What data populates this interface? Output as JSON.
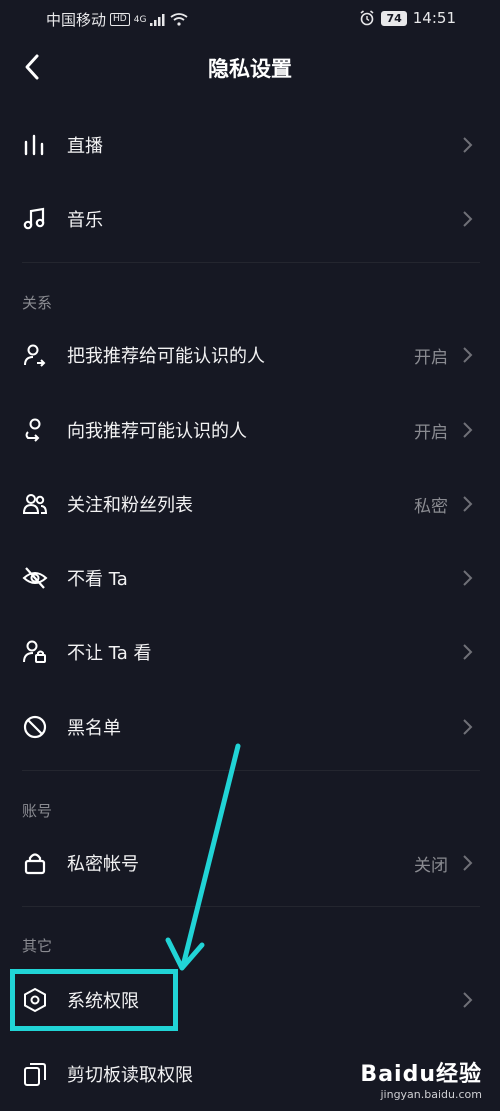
{
  "status_bar": {
    "carrier": "中国移动",
    "hd": "HD",
    "net": "4G",
    "battery": "74",
    "time": "14:51"
  },
  "header": {
    "title": "隐私设置"
  },
  "items_top": [
    {
      "label": "直播",
      "icon": "bars-icon"
    },
    {
      "label": "音乐",
      "icon": "music-note-icon"
    }
  ],
  "sections": {
    "relations": "关系",
    "account": "账号",
    "other": "其它"
  },
  "relations_items": [
    {
      "label": "把我推荐给可能认识的人",
      "value": "开启",
      "icon": "user-share-icon"
    },
    {
      "label": "向我推荐可能认识的人",
      "value": "开启",
      "icon": "user-recommend-icon"
    },
    {
      "label": "关注和粉丝列表",
      "value": "私密",
      "icon": "users-icon"
    },
    {
      "label": "不看 Ta",
      "value": "",
      "icon": "eye-off-icon"
    },
    {
      "label": "不让 Ta 看",
      "value": "",
      "icon": "user-lock-icon"
    },
    {
      "label": "黑名单",
      "value": "",
      "icon": "block-icon"
    }
  ],
  "account_items": [
    {
      "label": "私密帐号",
      "value": "关闭",
      "icon": "lock-icon"
    }
  ],
  "other_items": [
    {
      "label": "系统权限",
      "value": "",
      "icon": "hexagon-icon"
    },
    {
      "label": "剪切板读取权限",
      "value": "",
      "icon": "clipboard-icon"
    }
  ],
  "watermark": {
    "logo": "Baidu经验",
    "url": "jingyan.baidu.com"
  },
  "colors": {
    "background": "#161823",
    "highlight": "#21d4d6",
    "muted": "#8a8b91"
  }
}
